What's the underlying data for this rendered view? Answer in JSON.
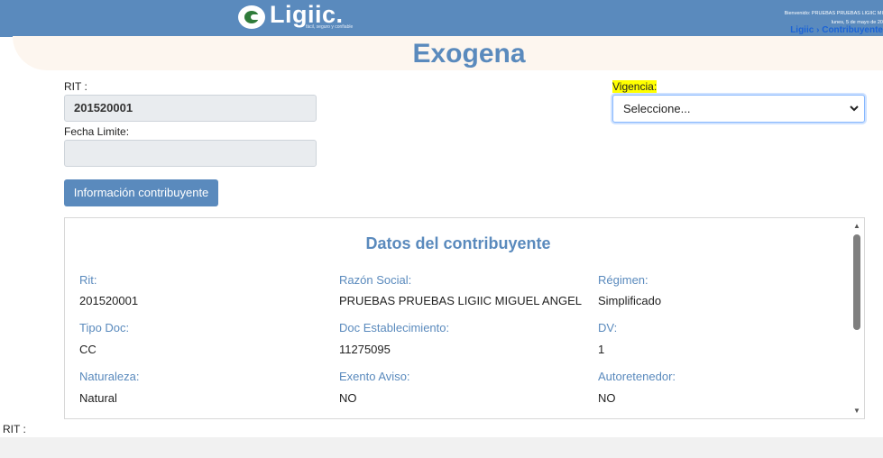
{
  "header": {
    "brand": "Ligiic.",
    "tagline": "fácil, seguro y confiable",
    "welcome": "Bienvenido: PRUEBAS PRUEBAS LIGIIC MI",
    "date": "lunes, 5 de mayo de 20",
    "breadcrumb_home": "Ligiic",
    "breadcrumb_sep": "›",
    "breadcrumb_current": "Contribuyente"
  },
  "page": {
    "title": "Exogena"
  },
  "form": {
    "rit_label": "RIT :",
    "rit_value": "201520001",
    "fecha_label": "Fecha Limite:",
    "fecha_value": "",
    "vigencia_label": "Vigencia:",
    "vigencia_selected": "Seleccione...",
    "info_button": "Información contribuyente"
  },
  "contribuyente": {
    "title": "Datos del contribuyente",
    "rows": [
      [
        {
          "label": "Rit:",
          "value": "201520001"
        },
        {
          "label": "Razón Social:",
          "value": "PRUEBAS PRUEBAS LIGIIC MIGUEL ANGEL"
        },
        {
          "label": "Régimen:",
          "value": "Simplificado"
        }
      ],
      [
        {
          "label": "Tipo Doc:",
          "value": "CC"
        },
        {
          "label": "Doc Establecimiento:",
          "value": "11275095"
        },
        {
          "label": "DV:",
          "value": "1"
        }
      ],
      [
        {
          "label": "Naturaleza:",
          "value": "Natural"
        },
        {
          "label": "Exento Aviso:",
          "value": "NO"
        },
        {
          "label": "Autoretenedor:",
          "value": "NO"
        }
      ]
    ]
  },
  "bottom": {
    "rit_label": "RIT :"
  },
  "colors": {
    "accent": "#5a8abd",
    "highlight": "#ffff00",
    "link": "#1b63d6"
  },
  "icons": {
    "select_chevron": "chevron-down-icon",
    "scroll_up": "arrow-up-icon",
    "scroll_down": "arrow-down-icon"
  }
}
